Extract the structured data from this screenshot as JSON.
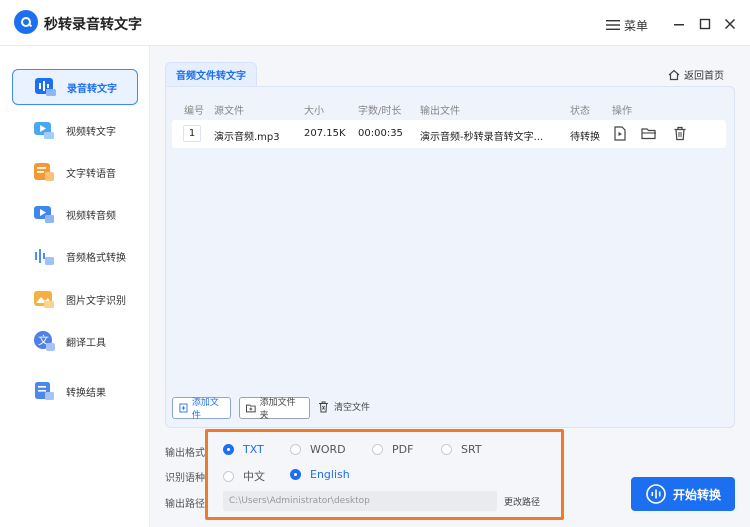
{
  "app": {
    "title": "秒转录音转文字",
    "menu_label": "菜单"
  },
  "sidebar": {
    "items": [
      {
        "label": "录音转文字",
        "icon": "audio-to-text-icon",
        "active": true
      },
      {
        "label": "视频转文字",
        "icon": "video-to-text-icon",
        "active": false
      },
      {
        "label": "文字转语音",
        "icon": "text-to-speech-icon",
        "active": false
      },
      {
        "label": "视频转音频",
        "icon": "video-to-audio-icon",
        "active": false
      },
      {
        "label": "音频格式转换",
        "icon": "audio-format-icon",
        "active": false
      },
      {
        "label": "图片文字识别",
        "icon": "image-ocr-icon",
        "active": false
      },
      {
        "label": "翻译工具",
        "icon": "translate-icon",
        "active": false
      },
      {
        "label": "转换结果",
        "icon": "results-icon",
        "active": false
      }
    ]
  },
  "main": {
    "tab_label": "音频文件转文字",
    "return_label": "返回首页",
    "table": {
      "headers": [
        "编号",
        "源文件",
        "大小",
        "字数/时长",
        "输出文件",
        "状态",
        "操作"
      ],
      "rows": [
        {
          "index": "1",
          "source": "演示音频.mp3",
          "size": "207.15K",
          "duration": "00:00:35",
          "output": "演示音频-秒转录音转文字...",
          "status": "待转换"
        }
      ]
    },
    "buttons": {
      "add_file": "添加文件",
      "add_folder": "添加文件夹",
      "clear": "清空文件"
    }
  },
  "options": {
    "format_label": "输出格式",
    "language_label": "识别语种",
    "path_label": "输出路径",
    "formats": [
      "TXT",
      "WORD",
      "PDF",
      "SRT"
    ],
    "selected_format": "TXT",
    "languages": [
      "中文",
      "English"
    ],
    "selected_language": "English",
    "output_path": "C:\\Users\\Administrator\\desktop",
    "change_path_label": "更改路径"
  },
  "start_button": "开始转换",
  "colors": {
    "accent": "#1d6ff2",
    "highlight": "#ef7a2a",
    "panel": "#eef3fc"
  }
}
